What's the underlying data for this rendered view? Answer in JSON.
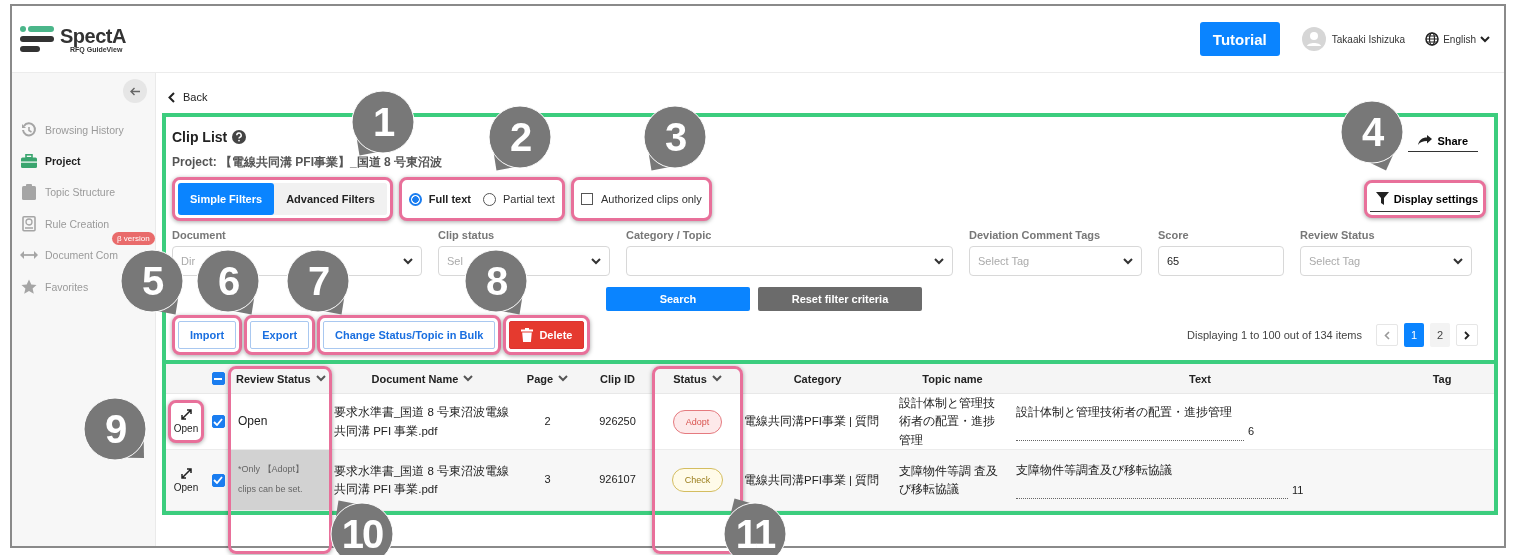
{
  "app": {
    "logo": "SpectA",
    "logo_subtitle": "RFQ GuideView"
  },
  "header": {
    "tutorial_button": "Tutorial",
    "user_name": "Takaaki Ishizuka",
    "language": "English"
  },
  "sidebar": {
    "items": [
      {
        "label": "Browsing History",
        "selected": false
      },
      {
        "label": "Project",
        "selected": true
      },
      {
        "label": "Topic Structure",
        "selected": false
      },
      {
        "label": "Rule Creation",
        "selected": false
      },
      {
        "label": "Document Com",
        "selected": false,
        "badge": "β version"
      },
      {
        "label": "Favorites",
        "selected": false
      }
    ]
  },
  "back_link": "Back",
  "clip_list": {
    "title": "Clip List",
    "project": "Project: 【電線共同溝 PFI事業】_国道 8 号東沼波",
    "share_button": "Share",
    "display_settings_button": "Display settings",
    "filter_tabs": [
      {
        "label": "Simple Filters",
        "selected": true
      },
      {
        "label": "Advanced Filters",
        "selected": false
      }
    ],
    "search_modes": [
      {
        "label": "Full text",
        "selected": true
      },
      {
        "label": "Partial text",
        "selected": false
      }
    ],
    "authorized_only": {
      "label": "Authorized clips only",
      "checked": false
    },
    "filters": [
      {
        "label": "Document",
        "kind": "select",
        "placeholder": "Dir"
      },
      {
        "label": "Clip status",
        "kind": "select",
        "placeholder": "Sel"
      },
      {
        "label": "Category / Topic",
        "kind": "select"
      },
      {
        "label": "Deviation Comment Tags",
        "kind": "select",
        "placeholder": "Select Tag"
      },
      {
        "label": "Score",
        "kind": "text",
        "value": "65"
      },
      {
        "label": "Review Status",
        "kind": "select",
        "placeholder": "Select Tag"
      }
    ],
    "search_button": "Search",
    "reset_button": "Reset filter criteria",
    "actions": [
      {
        "label": "Import",
        "kind": "outline"
      },
      {
        "label": "Export",
        "kind": "outline"
      },
      {
        "label": "Change Status/Topic in Bulk",
        "kind": "outline"
      },
      {
        "label": "Delete",
        "kind": "danger"
      }
    ],
    "pagination": {
      "summary": "Displaying 1 to 100 out of 134 items",
      "pages": [
        {
          "label": "1",
          "selected": true
        },
        {
          "label": "2",
          "selected": false
        }
      ]
    }
  },
  "table": {
    "select_all_partial": true,
    "columns": [
      {
        "label": "Review Status",
        "sortable": true
      },
      {
        "label": "Document Name",
        "sortable": true
      },
      {
        "label": "Page",
        "sortable": true
      },
      {
        "label": "Clip ID",
        "sortable": false
      },
      {
        "label": "Status",
        "sortable": true
      },
      {
        "label": "Category",
        "sortable": false
      },
      {
        "label": "Topic name",
        "sortable": false
      },
      {
        "label": "Text",
        "sortable": false
      },
      {
        "label": "Tag",
        "sortable": false
      }
    ],
    "rows": [
      {
        "open_label": "Open",
        "checked": true,
        "review_status": "Open",
        "restricted": false,
        "document_name": "要求水準書_国道 8 号東沼波電線共同溝 PFI 事業.pdf",
        "page": "2",
        "clip_id": "926250",
        "status": {
          "label": "Adopt",
          "kind": "adopt"
        },
        "category": "電線共同溝PFI事業 | 質問",
        "topic": "設計体制と管理技術者の配置・進捗管理",
        "text": "設計体制と管理技術者の配置・進捗管理",
        "text_page": "6"
      },
      {
        "open_label": "Open",
        "checked": true,
        "review_status": "*Only 【Adopt】 clips can be set.",
        "restricted": true,
        "document_name": "要求水準書_国道 8 号東沼波電線共同溝 PFI 事業.pdf",
        "page": "3",
        "clip_id": "926107",
        "status": {
          "label": "Check",
          "kind": "check"
        },
        "category": "電線共同溝PFI事業 | 質問",
        "topic": "支障物件等調 査及び移転協議",
        "text": "支障物件等調査及び移転協議",
        "text_page": "11"
      }
    ]
  },
  "callouts": [
    {
      "number": "1"
    },
    {
      "number": "2"
    },
    {
      "number": "3"
    },
    {
      "number": "4"
    },
    {
      "number": "5"
    },
    {
      "number": "6"
    },
    {
      "number": "7"
    },
    {
      "number": "8"
    },
    {
      "number": "9"
    },
    {
      "number": "10"
    },
    {
      "number": "11"
    }
  ]
}
